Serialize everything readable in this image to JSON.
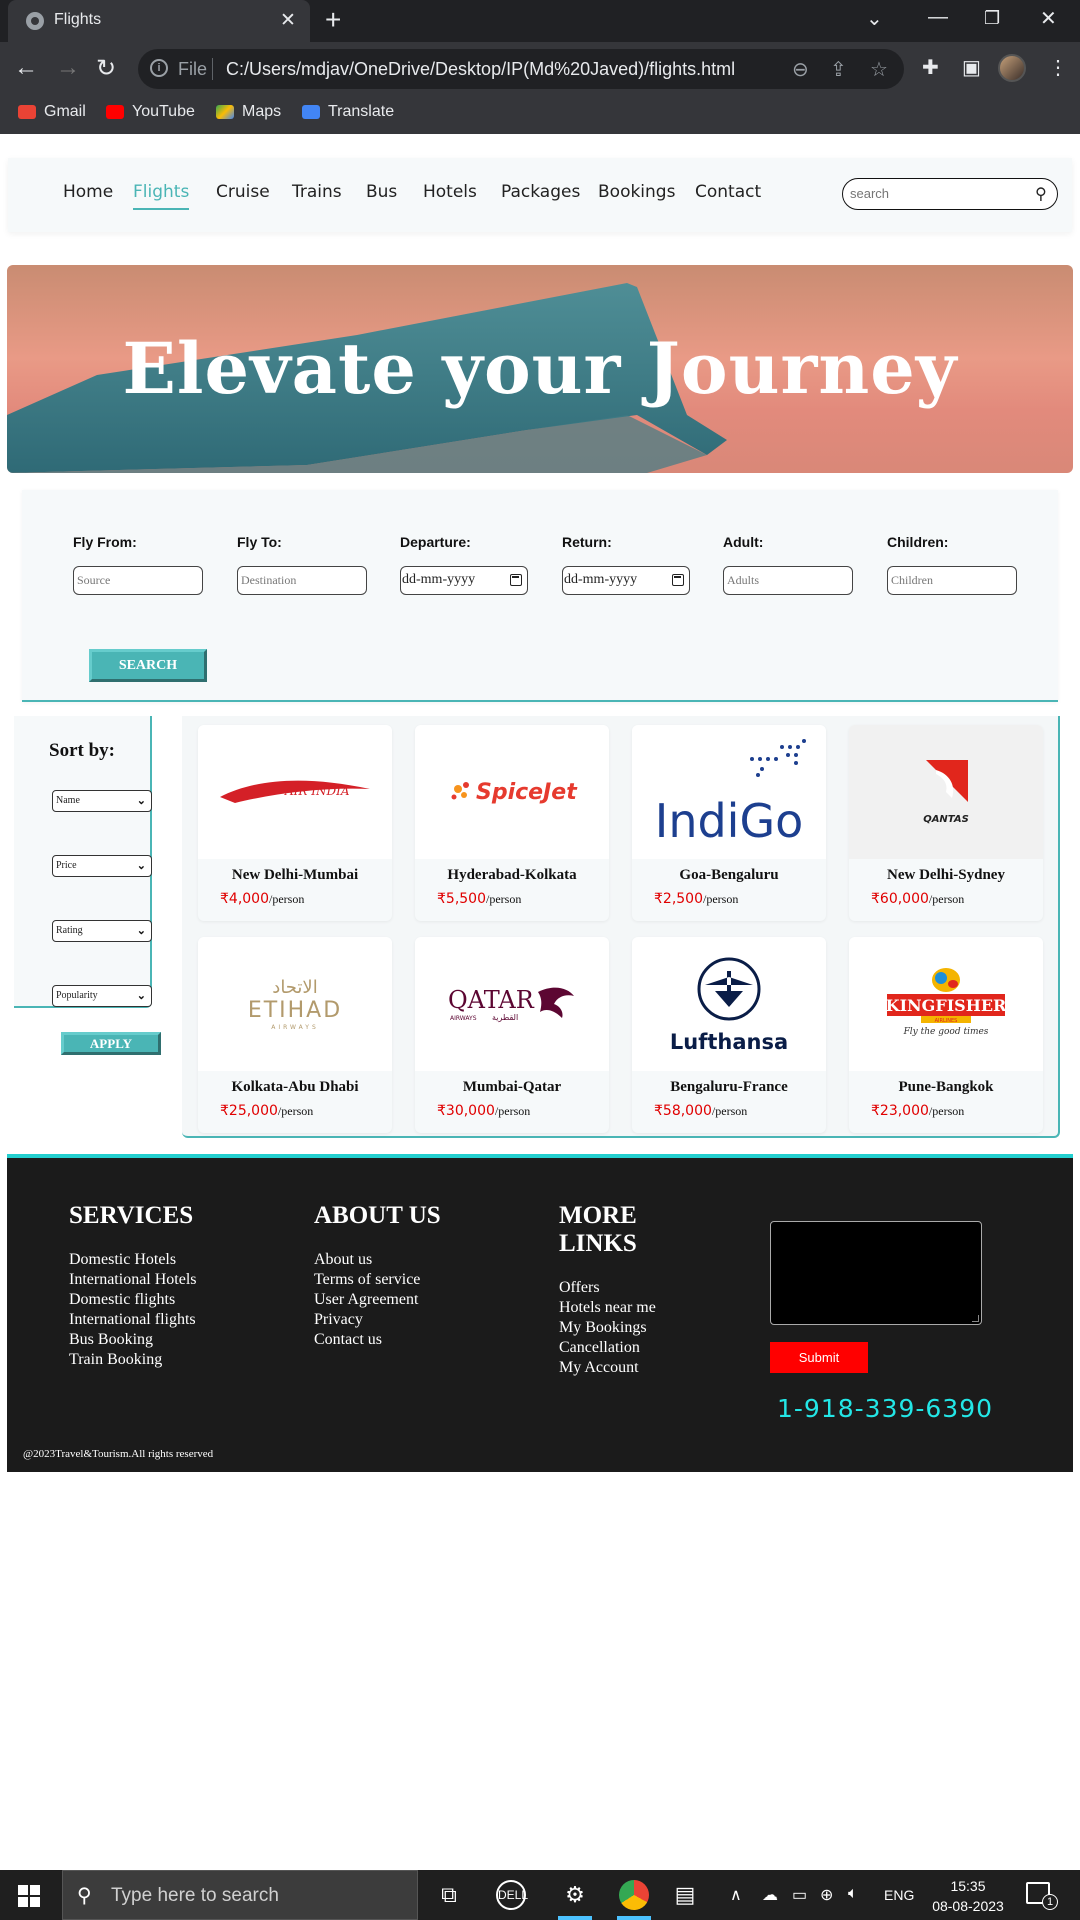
{
  "browser": {
    "tab_title": "Flights",
    "tab_close": "✕",
    "new_tab": "+",
    "address_scheme": "File",
    "address_url": "C:/Users/mdjav/OneDrive/Desktop/IP(Md%20Javed)/flights.html",
    "bookmarks": [
      {
        "label": "Gmail",
        "color": "#ea4335"
      },
      {
        "label": "YouTube",
        "color": "#ff0000"
      },
      {
        "label": "Maps",
        "color": "#34a853"
      },
      {
        "label": "Translate",
        "color": "#4285f4"
      }
    ]
  },
  "nav": {
    "links": [
      "Home",
      "Flights",
      "Cruise",
      "Trains",
      "Bus",
      "Hotels",
      "Packages",
      "Bookings",
      "Contact"
    ],
    "active": "Flights",
    "search_placeholder": "search"
  },
  "hero": {
    "title": "Elevate your Journey"
  },
  "search_form": {
    "fields": [
      {
        "label": "Fly From:",
        "placeholder": "Source"
      },
      {
        "label": "Fly To:",
        "placeholder": "Destination"
      },
      {
        "label": "Departure:",
        "value": "dd-mm-yyyy"
      },
      {
        "label": "Return:",
        "value": "dd-mm-yyyy"
      },
      {
        "label": "Adult:",
        "placeholder": "Adults"
      },
      {
        "label": "Children:",
        "placeholder": "Children"
      }
    ],
    "button": "SEARCH"
  },
  "sort": {
    "title": "Sort by:",
    "selects": [
      "Name",
      "Price",
      "Rating",
      "Popularity"
    ],
    "apply": "APPLY"
  },
  "flights": [
    {
      "logo": "AIR INDIA",
      "route": "New Delhi-Mumbai",
      "price": "₹4,000",
      "unit": "/person"
    },
    {
      "logo": "SpiceJet",
      "route": "Hyderabad-Kolkata",
      "price": "₹5,500",
      "unit": "/person"
    },
    {
      "logo": "IndiGo",
      "route": "Goa-Bengaluru",
      "price": "₹2,500",
      "unit": "/person"
    },
    {
      "logo": "QANTAS",
      "route": "New Delhi-Sydney",
      "price": "₹60,000",
      "unit": "/person"
    },
    {
      "logo": "ETIHAD",
      "logo_sub": "AIRWAYS",
      "logo_ar": "الاتحاد",
      "route": "Kolkata-Abu Dhabi",
      "price": "₹25,000",
      "unit": "/person"
    },
    {
      "logo": "QATAR",
      "logo_sub": "AIRWAYS",
      "logo_ar": "القطرية",
      "route": "Mumbai-Qatar",
      "price": "₹30,000",
      "unit": "/person"
    },
    {
      "logo": "Lufthansa",
      "route": "Bengaluru-France",
      "price": "₹58,000",
      "unit": "/person"
    },
    {
      "logo": "KINGFISHER",
      "logo_sub": "AIRLINES",
      "logo_tagline": "Fly the good times",
      "route": "Pune-Bangkok",
      "price": "₹23,000",
      "unit": "/person"
    }
  ],
  "footer": {
    "services": {
      "title": "SERVICES",
      "items": [
        "Domestic Hotels",
        "International Hotels",
        "Domestic flights",
        "International flights",
        "Bus Booking",
        "Train Booking"
      ]
    },
    "about": {
      "title": "ABOUT US",
      "items": [
        "About us",
        "Terms of service",
        "User Agreement",
        "Privacy",
        "Contact us"
      ]
    },
    "more": {
      "title_line1": "MORE",
      "title_line2": "LINKS",
      "items": [
        "Offers",
        "Hotels near me",
        "My Bookings",
        "Cancellation",
        "My Account"
      ]
    },
    "submit": "Submit",
    "phone": "1-918-339-6390",
    "copyright": "@2023Travel&Tourism.All rights reserved"
  },
  "taskbar": {
    "search_placeholder": "Type here to search",
    "lang": "ENG",
    "time": "15:35",
    "date": "08-08-2023",
    "notifications": "1"
  },
  "colors": {
    "accent": "#4ab5b5",
    "price": "#e00000",
    "phone": "#23e6e6",
    "submit": "#ff0000"
  }
}
